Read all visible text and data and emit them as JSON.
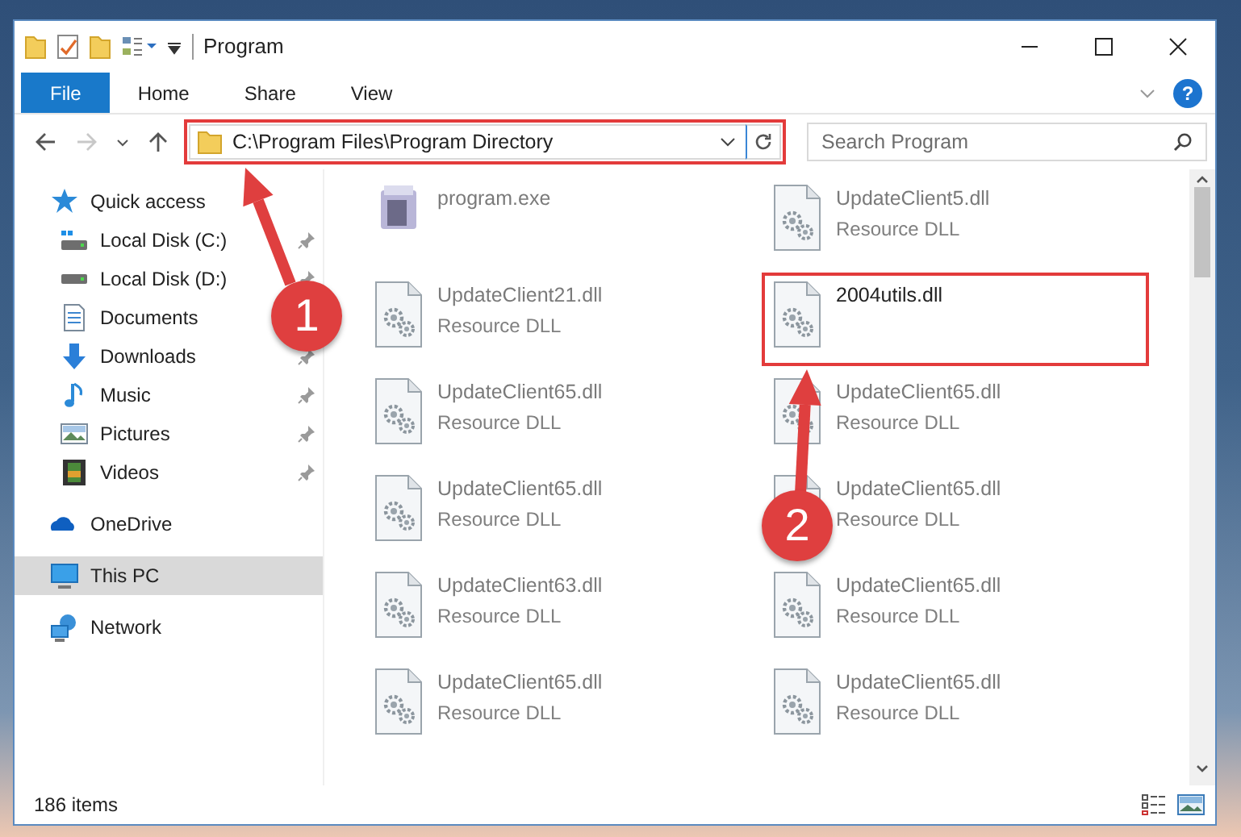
{
  "window": {
    "title": "Program"
  },
  "ribbon": {
    "tabs": [
      {
        "label": "File",
        "kind": "file"
      },
      {
        "label": "Home",
        "kind": "tab"
      },
      {
        "label": "Share",
        "kind": "tab"
      },
      {
        "label": "View",
        "kind": "tab"
      }
    ],
    "help": "?"
  },
  "navigation": {
    "back_enabled": true,
    "forward_enabled": false,
    "address": {
      "path": "C:\\Program Files\\Program Directory",
      "highlighted": true
    },
    "search": {
      "placeholder": "Search Program"
    }
  },
  "sidebar": {
    "items": [
      {
        "label": "Quick access",
        "kind": "star",
        "selected": false,
        "children": [
          {
            "label": "Local Disk (C:)",
            "kind": "drive-c",
            "pinned": true
          },
          {
            "label": "Local Disk (D:)",
            "kind": "drive",
            "pinned": true
          },
          {
            "label": "Documents",
            "kind": "documents"
          },
          {
            "label": "Downloads",
            "kind": "downloads",
            "pinned": true
          },
          {
            "label": "Music",
            "kind": "music",
            "pinned": true
          },
          {
            "label": "Pictures",
            "kind": "pictures",
            "pinned": true
          },
          {
            "label": "Videos",
            "kind": "videos",
            "pinned": true
          }
        ]
      },
      {
        "label": "OneDrive",
        "kind": "cloud",
        "selected": false
      },
      {
        "label": "This PC",
        "kind": "pc",
        "selected": true
      },
      {
        "label": "Network",
        "kind": "network",
        "selected": false
      }
    ]
  },
  "files": [
    {
      "name": "program.exe",
      "kind": "exe",
      "blurred": true,
      "highlighted": false
    },
    {
      "name": "UpdateClient5.dll",
      "type_label": "Resource DLL",
      "kind": "dll",
      "blurred": true,
      "highlighted": false
    },
    {
      "name": "UpdateClient21.dll",
      "type_label": "Resource DLL",
      "kind": "dll",
      "blurred": true,
      "highlighted": false
    },
    {
      "name": "2004utils.dll",
      "kind": "dll",
      "blurred": false,
      "highlighted": true
    },
    {
      "name": "UpdateClient65.dll",
      "type_label": "Resource DLL",
      "kind": "dll",
      "blurred": true,
      "highlighted": false
    },
    {
      "name": "UpdateClient65.dll",
      "type_label": "Resource DLL",
      "kind": "dll",
      "blurred": true,
      "highlighted": false
    },
    {
      "name": "UpdateClient65.dll",
      "type_label": "Resource DLL",
      "kind": "dll",
      "blurred": true,
      "highlighted": false
    },
    {
      "name": "UpdateClient65.dll",
      "type_label": "Resource DLL",
      "kind": "dll",
      "blurred": true,
      "highlighted": false
    },
    {
      "name": "UpdateClient63.dll",
      "type_label": "Resource DLL",
      "kind": "dll",
      "blurred": true,
      "highlighted": false
    },
    {
      "name": "UpdateClient65.dll",
      "type_label": "Resource DLL",
      "kind": "dll",
      "blurred": true,
      "highlighted": false
    },
    {
      "name": "UpdateClient65.dll",
      "type_label": "Resource DLL",
      "kind": "dll",
      "blurred": true,
      "highlighted": false
    },
    {
      "name": "UpdateClient65.dll",
      "type_label": "Resource DLL",
      "kind": "dll",
      "blurred": true,
      "highlighted": false
    }
  ],
  "status_bar": {
    "item_count": "186 items"
  },
  "annotations": [
    {
      "number": "1"
    },
    {
      "number": "2"
    }
  ]
}
